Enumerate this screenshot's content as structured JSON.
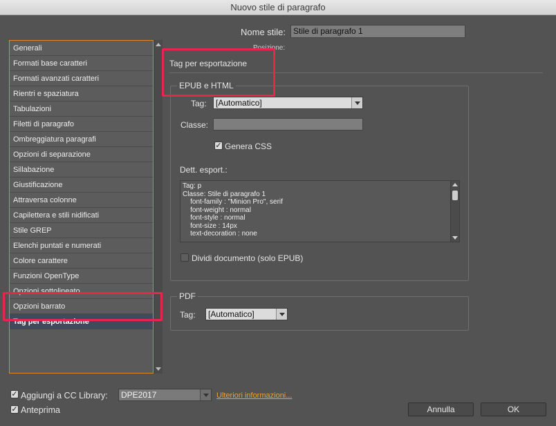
{
  "window": {
    "title": "Nuovo stile di paragrafo"
  },
  "sidebar": {
    "items": [
      {
        "label": "Generali"
      },
      {
        "label": "Formati base caratteri"
      },
      {
        "label": "Formati avanzati caratteri"
      },
      {
        "label": "Rientri e spaziatura"
      },
      {
        "label": "Tabulazioni"
      },
      {
        "label": "Filetti di paragrafo"
      },
      {
        "label": "Ombreggiatura paragrafi"
      },
      {
        "label": "Opzioni di separazione"
      },
      {
        "label": "Sillabazione"
      },
      {
        "label": "Giustificazione"
      },
      {
        "label": "Attraversa colonne"
      },
      {
        "label": "Capilettera e stili nidificati"
      },
      {
        "label": "Stile GREP"
      },
      {
        "label": "Elenchi puntati e numerati"
      },
      {
        "label": "Colore carattere"
      },
      {
        "label": "Funzioni OpenType"
      },
      {
        "label": "Opzioni sottolineato"
      },
      {
        "label": "Opzioni barrato"
      },
      {
        "label": "Tag per esportazione"
      }
    ],
    "selected": "Tag per esportazione"
  },
  "header": {
    "style_name_label": "Nome stile:",
    "style_name_value": "Stile di paragrafo 1",
    "position_label": "Posizione:"
  },
  "section": {
    "title": "Tag per esportazione"
  },
  "epub": {
    "legend": "EPUB e HTML",
    "tag_label": "Tag:",
    "tag_value": "[Automatico]",
    "class_label": "Classe:",
    "class_value": "",
    "generate_css_label": "Genera CSS",
    "generate_css_checked": true,
    "details_label": "Dett. esport.:",
    "details_lines": [
      "Tag: p",
      "Classe: Stile di paragrafo 1",
      "    font-family : \"Minion Pro\", serif",
      "    font-weight : normal",
      "    font-style : normal",
      "    font-size : 14px",
      "    text-decoration : none"
    ],
    "split_doc_label": "Dividi documento (solo EPUB)",
    "split_doc_checked": false
  },
  "pdf": {
    "legend": "PDF",
    "tag_label": "Tag:",
    "tag_value": "[Automatico]"
  },
  "footer": {
    "add_cc_label": "Aggiungi a CC Library:",
    "add_cc_checked": true,
    "library_value": "DPE2017",
    "more_info_link": "Ulteriori informazioni...",
    "preview_label": "Anteprima",
    "preview_checked": true,
    "cancel_label": "Annulla",
    "ok_label": "OK"
  },
  "colors": {
    "highlight": "#e8264d",
    "sidebar_border": "#d88a2a",
    "link": "#f0a13a",
    "background": "#535353"
  }
}
